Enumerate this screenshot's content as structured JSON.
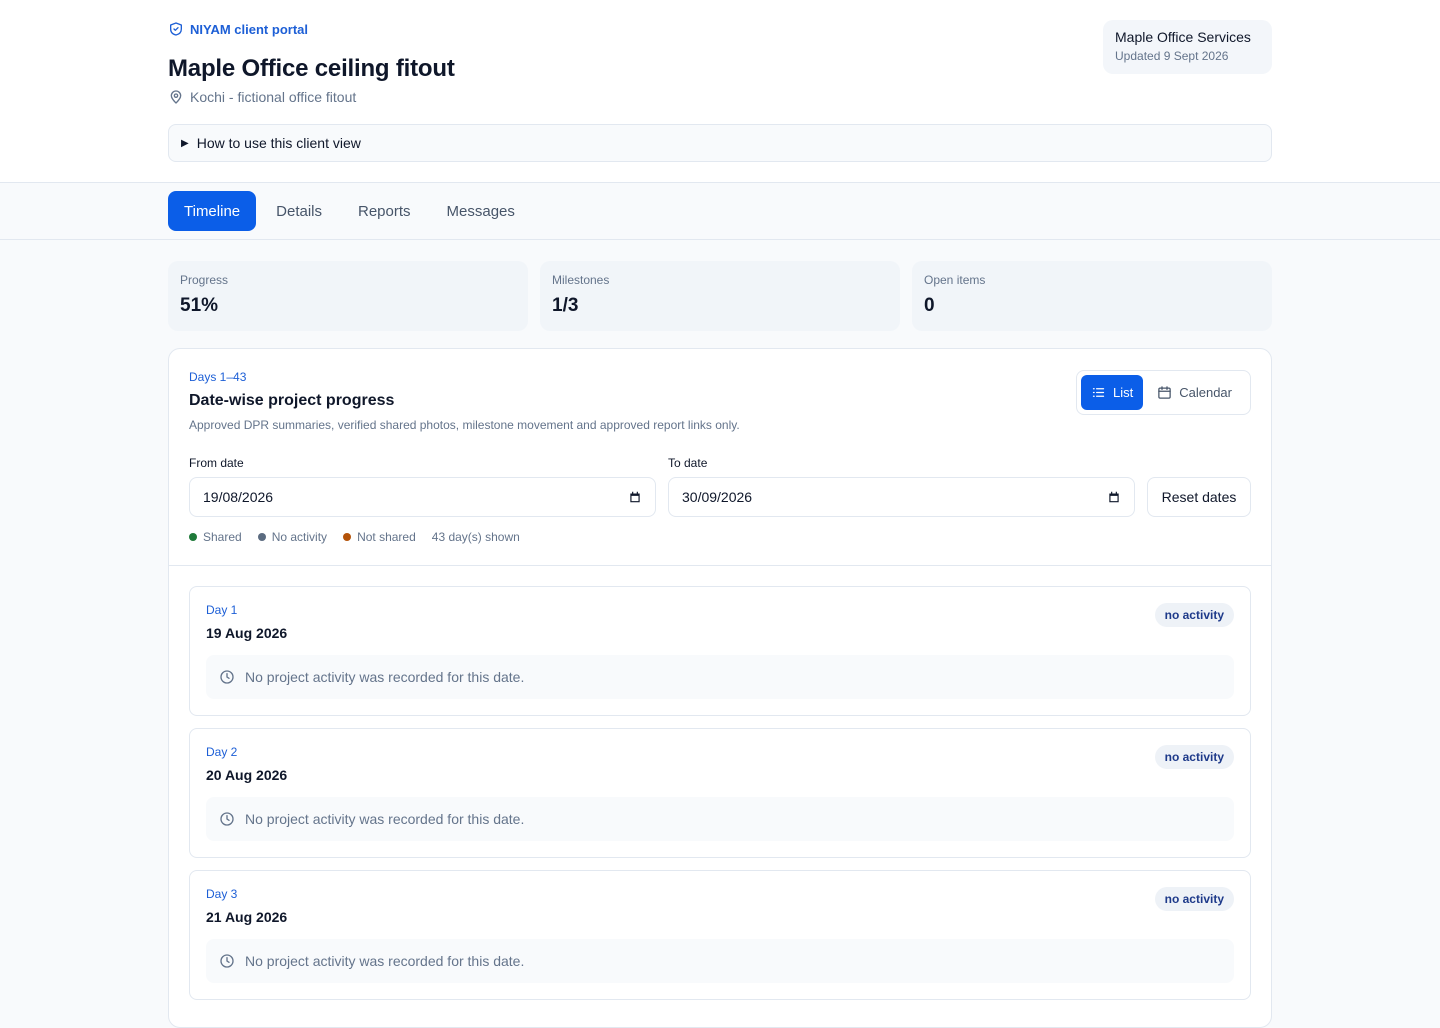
{
  "header": {
    "brand": "NIYAM client portal",
    "title": "Maple Office ceiling fitout",
    "location": "Kochi - fictional office fitout",
    "client_name": "Maple Office Services",
    "updated": "Updated 9 Sept 2026",
    "howto": "How to use this client view"
  },
  "tabs": [
    {
      "label": "Timeline",
      "active": true
    },
    {
      "label": "Details"
    },
    {
      "label": "Reports"
    },
    {
      "label": "Messages"
    }
  ],
  "stats": [
    {
      "label": "Progress",
      "value": "51%"
    },
    {
      "label": "Milestones",
      "value": "1/3"
    },
    {
      "label": "Open items",
      "value": "0"
    }
  ],
  "timeline": {
    "eyebrow": "Days 1–43",
    "title": "Date-wise project progress",
    "description": "Approved DPR summaries, verified shared photos, milestone movement and approved report links only.",
    "view_list": "List",
    "view_calendar": "Calendar",
    "from_label": "From date",
    "from_value": "19/08/2026",
    "to_label": "To date",
    "to_value": "30/09/2026",
    "reset": "Reset dates",
    "legend": {
      "shared": "Shared",
      "no_activity": "No activity",
      "not_shared": "Not shared",
      "shown": "43 day(s) shown"
    },
    "colors": {
      "shared": "#1f7a3a",
      "no_activity": "#5b6b80",
      "not_shared": "#b45309",
      "accent": "#0b5ee8"
    },
    "days": [
      {
        "label": "Day 1",
        "date": "19 Aug 2026",
        "status": "no activity",
        "note": "No project activity was recorded for this date."
      },
      {
        "label": "Day 2",
        "date": "20 Aug 2026",
        "status": "no activity",
        "note": "No project activity was recorded for this date."
      },
      {
        "label": "Day 3",
        "date": "21 Aug 2026",
        "status": "no activity",
        "note": "No project activity was recorded for this date."
      }
    ]
  }
}
